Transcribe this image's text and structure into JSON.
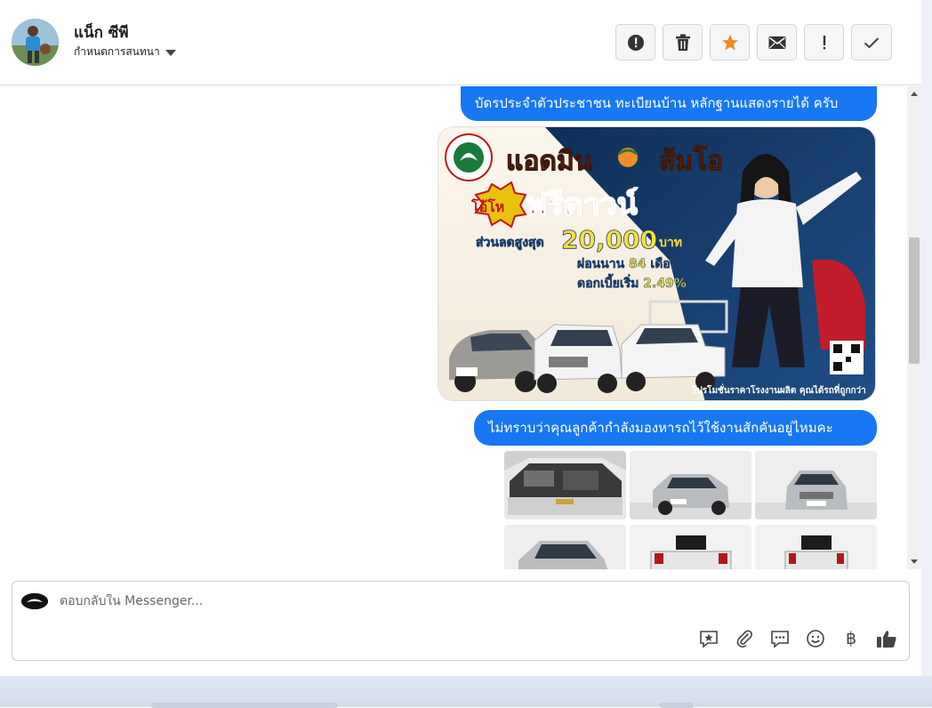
{
  "header": {
    "contact_name": "แน็ก ซีพี",
    "assign_label": "กำหนดการสนทนา",
    "actions": [
      {
        "name": "spam-button",
        "icon": "alert-circle-icon"
      },
      {
        "name": "delete-button",
        "icon": "trash-icon"
      },
      {
        "name": "star-button",
        "icon": "star-icon"
      },
      {
        "name": "mark-unread-button",
        "icon": "envelope-icon"
      },
      {
        "name": "follow-up-button",
        "icon": "exclamation-icon"
      },
      {
        "name": "done-button",
        "icon": "check-icon"
      }
    ]
  },
  "messages": {
    "msg1": "บัดรประจำตัวประชาชน ทะเบียนบ้าน หลักฐานแสดงรายได้ ครับ",
    "msg2": "ไม่ทราบว่าคุณลูกค้ากำลังมองหารถไว้ใช้งานสักคันอยู่ไหมคะ"
  },
  "ad": {
    "headline1": "แอดมิน",
    "headline2": "ส้มโอ",
    "badge": "โอ้โห",
    "offer": "ฟรีดาวน์",
    "discount_label": "ส่วนลดสูงสุด",
    "discount_value": "20,000",
    "discount_unit": "บาท",
    "installment": "ผ่อนนาน 84 เดือน",
    "interest": "ดอกเบี้ยเริ่ม 2.49%",
    "footer": "โปรโมชั่นราคาโรงงานผลิต คุณได้รถที่ถูกกว่า"
  },
  "composer": {
    "placeholder": "ตอบกลับใน Messenger...",
    "tools": [
      "saved-reply-icon",
      "attachment-icon",
      "chat-bubble-icon",
      "emoji-icon",
      "baht-icon",
      "thumbs-up-icon"
    ],
    "baht_glyph": "฿"
  },
  "colors": {
    "accent": "#1877f2",
    "star": "#f28c28"
  }
}
